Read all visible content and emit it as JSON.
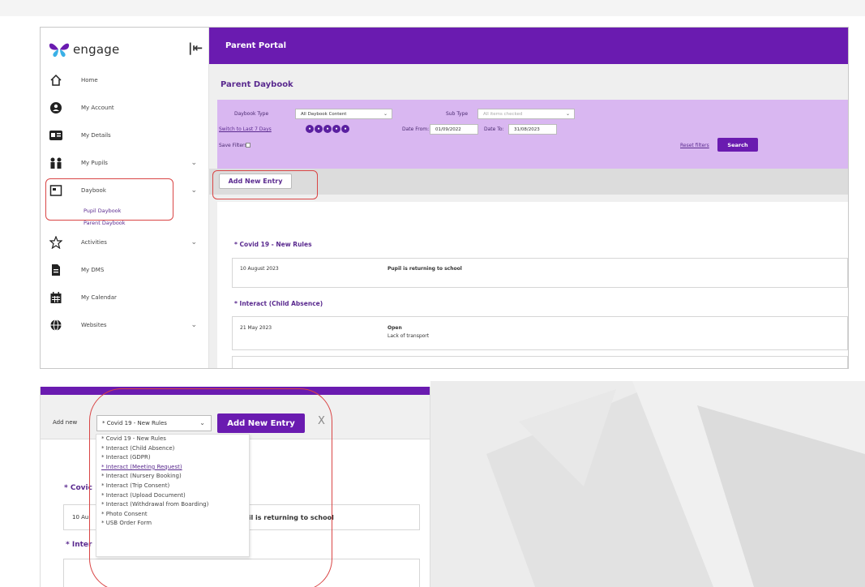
{
  "brand": {
    "logo_text": "engage",
    "logo_color": "#6a1bb0"
  },
  "colors": {
    "accent": "#6a1bb0",
    "filter_bg": "#d9b7f1",
    "highlight": "#d94545"
  },
  "sidebar": {
    "items": [
      {
        "label": "Home",
        "icon": "home-icon"
      },
      {
        "label": "My Account",
        "icon": "account-icon"
      },
      {
        "label": "My Details",
        "icon": "id-card-icon"
      },
      {
        "label": "My Pupils",
        "icon": "people-icon"
      },
      {
        "label": "Daybook",
        "icon": "daybook-icon"
      },
      {
        "label": "Activities",
        "icon": "star-icon"
      },
      {
        "label": "My DMS",
        "icon": "document-icon"
      },
      {
        "label": "My Calendar",
        "icon": "calendar-icon"
      },
      {
        "label": "Websites",
        "icon": "globe-icon"
      }
    ],
    "daybook_sub": [
      "Pupil Daybook",
      "Parent Daybook"
    ]
  },
  "header": {
    "title": "Parent Portal"
  },
  "page": {
    "title": "Parent Daybook"
  },
  "filters": {
    "daybook_type_label": "Daybook Type",
    "daybook_type_value": "All Daybook Content",
    "sub_type_label": "Sub Type",
    "sub_type_value": "All items checked",
    "switch_label": "Switch to Last 7 Days",
    "date_from_label": "Date From:",
    "date_from_value": "01/09/2022",
    "date_to_label": "Date To:",
    "date_to_value": "31/08/2023",
    "save_filters_label": "Save Filters:",
    "reset_label": "Reset filters",
    "search_label": "Search"
  },
  "toolbar": {
    "add_label": "Add New Entry"
  },
  "groups": [
    {
      "title": "* Covid 19 - New Rules",
      "date": "10 August 2023",
      "text": "Pupil is returning to school",
      "note": ""
    },
    {
      "title": "* Interact (Child Absence)",
      "date": "21 May 2023",
      "text": "Open",
      "note": "Lack of transport"
    }
  ],
  "bottom": {
    "add_new_label": "Add new",
    "selected": "* Covid 19 - New Rules",
    "add_button": "Add New Entry",
    "close": "X",
    "options": [
      "* Covid 19 - New Rules",
      "* Interact (Child Absence)",
      "* Interact (GDPR)",
      "* Interact (Meeting Request)",
      "* Interact (Nursery Booking)",
      "* Interact (Trip Consent)",
      "* Interact (Upload Document)",
      "* Interact (Withdrawal from Boarding)",
      "* Photo Consent",
      "* USB Order Form"
    ],
    "behind": {
      "covid": "* Covic",
      "date": "10 Au",
      "pupil": "pil is returning to school",
      "inter": "* Inter"
    }
  }
}
